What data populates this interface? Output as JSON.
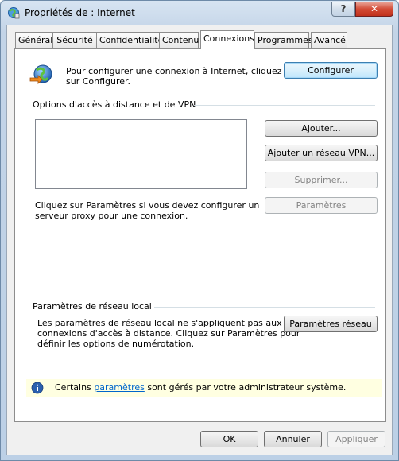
{
  "window": {
    "title": "Propriétés de : Internet",
    "help_label": "?",
    "close_label": "✕"
  },
  "tabs": [
    {
      "label": "Général"
    },
    {
      "label": "Sécurité"
    },
    {
      "label": "Confidentialité"
    },
    {
      "label": "Contenu"
    },
    {
      "label": "Connexions",
      "active": true
    },
    {
      "label": "Programmes"
    },
    {
      "label": "Avancé"
    }
  ],
  "setup": {
    "text_line1": "Pour configurer une connexion à Internet, cliquez",
    "text_line2": "sur Configurer.",
    "button": "Configurer",
    "icon": "internet-globe-icon"
  },
  "dialup": {
    "group_label": "Options d'accès à distance et de VPN",
    "add_button": "Ajouter...",
    "add_vpn_button": "Ajouter un réseau VPN...",
    "remove_button": "Supprimer...",
    "settings_button": "Paramètres",
    "proxy_text_line1": "Cliquez sur Paramètres si vous devez configurer un",
    "proxy_text_line2": "serveur proxy pour une connexion."
  },
  "lan": {
    "group_label": "Paramètres de réseau local",
    "text_line1": "Les paramètres de réseau local ne s'appliquent pas aux",
    "text_line2": "connexions d'accès à distance. Cliquez sur Paramètres pour",
    "text_line3": "définir les options de numérotation.",
    "button": "Paramètres réseau"
  },
  "info": {
    "prefix": "Certains ",
    "link": "paramètres",
    "suffix": " sont gérés par votre administrateur système.",
    "icon": "info-icon"
  },
  "footer": {
    "ok": "OK",
    "cancel": "Annuler",
    "apply": "Appliquer"
  }
}
